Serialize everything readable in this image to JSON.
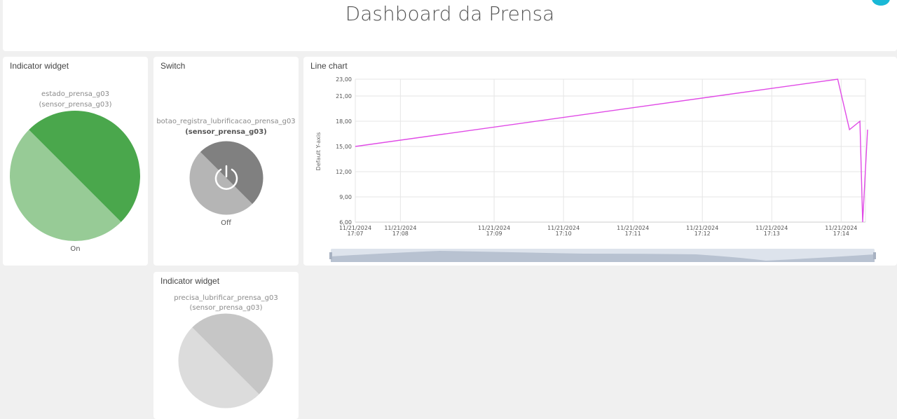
{
  "header": {
    "title": "Dashboard da Prensa"
  },
  "indicator1": {
    "title": "Indicator widget",
    "key": "estado_prensa_g03",
    "device": "(sensor_prensa_g03)",
    "state": "On",
    "color_light": "#97cb96",
    "color_dark": "#4aa74c"
  },
  "switch": {
    "title": "Switch",
    "key": "botao_registra_lubrificacao_prensa_g03",
    "device": "(sensor_prensa_g03)",
    "state": "Off"
  },
  "chart": {
    "title": "Line chart",
    "ylabel": "Default Y-axis",
    "line_color": "#e04ae6"
  },
  "indicator2": {
    "title": "Indicator widget",
    "key": "precisa_lubrificar_prensa_g03",
    "device": "(sensor_prensa_g03)"
  },
  "chart_data": {
    "type": "line",
    "ylabel": "Default Y-axis",
    "ylim": [
      6,
      23
    ],
    "yticks": [
      "6,00",
      "9,00",
      "12,00",
      "15,00",
      "18,00",
      "21,00",
      "23,00"
    ],
    "ytick_values": [
      6,
      9,
      12,
      15,
      18,
      21,
      23
    ],
    "xlim": [
      7.0,
      14.35
    ],
    "xticks": [
      {
        "date": "11/21/2024",
        "time": "17:07",
        "t": 7.0
      },
      {
        "date": "11/21/2024",
        "time": "17:08",
        "t": 7.65
      },
      {
        "date": "11/21/2024",
        "time": "17:09",
        "t": 9.0
      },
      {
        "date": "11/21/2024",
        "time": "17:10",
        "t": 10.0
      },
      {
        "date": "11/21/2024",
        "time": "17:11",
        "t": 11.0
      },
      {
        "date": "11/21/2024",
        "time": "17:12",
        "t": 12.0
      },
      {
        "date": "11/21/2024",
        "time": "17:13",
        "t": 13.0
      },
      {
        "date": "11/21/2024",
        "time": "17:14",
        "t": 14.0
      }
    ],
    "series": [
      {
        "x": [
          7.0,
          13.95,
          14.12,
          14.27,
          14.31,
          14.38
        ],
        "y": [
          15,
          23,
          17,
          18,
          6,
          17
        ]
      }
    ],
    "grid": true
  }
}
